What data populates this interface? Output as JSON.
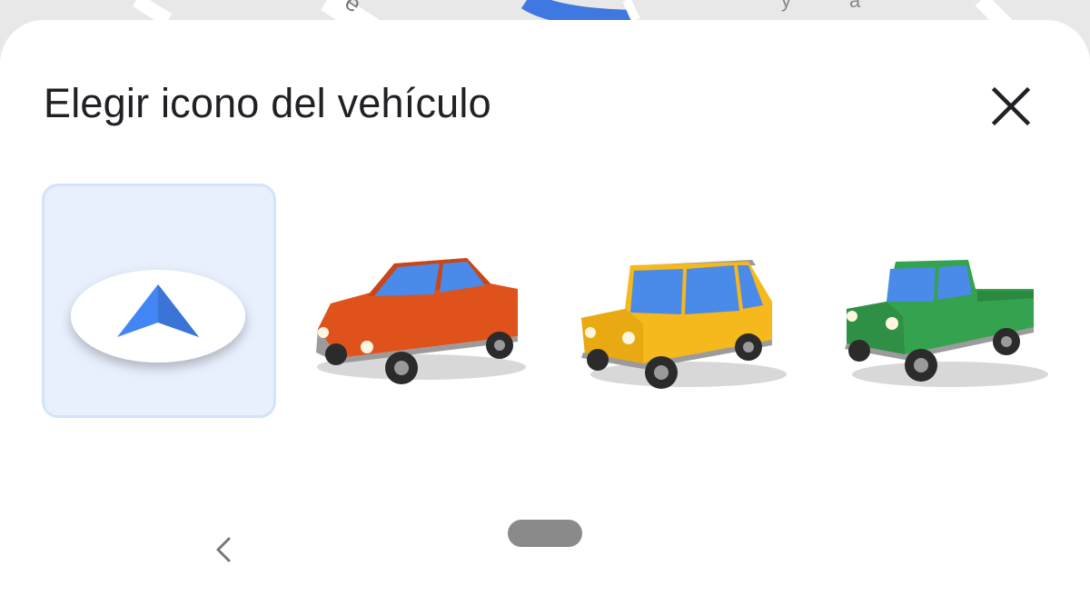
{
  "dialog": {
    "title": "Elegir icono del vehículo",
    "close_icon": "close-icon"
  },
  "vehicle_options": [
    {
      "name": "navigation-arrow",
      "icon": "navigation-arrow-icon",
      "selected": true
    },
    {
      "name": "red-sedan",
      "icon": "car-icon",
      "selected": false
    },
    {
      "name": "yellow-suv",
      "icon": "suv-icon",
      "selected": false
    },
    {
      "name": "green-pickup",
      "icon": "pickup-truck-icon",
      "selected": false
    }
  ],
  "nav_bar": {
    "back_icon": "chevron-left-icon",
    "home_icon": "home-pill"
  },
  "colors": {
    "selected_bg": "#e8f0fe",
    "selected_border": "#d2e3fc",
    "arrow": "#4285f4",
    "sedan": "#e0521b",
    "suv": "#f5b81d",
    "pickup": "#34a24e",
    "window": "#4a8ae8"
  }
}
